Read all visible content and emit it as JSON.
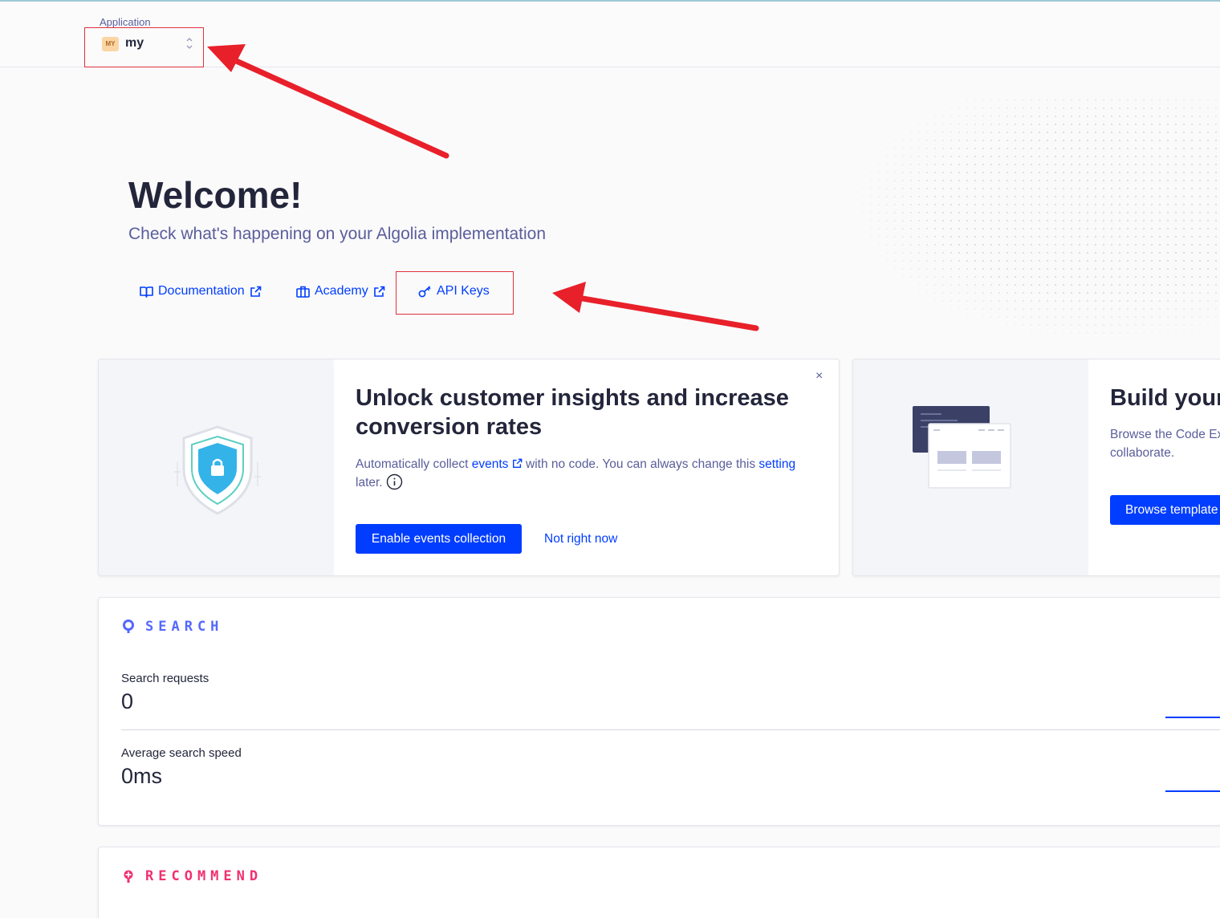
{
  "app_selector": {
    "label": "Application",
    "badge": "MY",
    "name": "my"
  },
  "welcome": {
    "title": "Welcome!",
    "subtitle": "Check what's happening on your Algolia implementation"
  },
  "links": {
    "documentation": "Documentation",
    "academy": "Academy",
    "api_keys": "API Keys"
  },
  "events_card": {
    "title_line1": "Unlock customer insights and increase",
    "title_line2": "conversion rates",
    "text_prefix": "Automatically collect ",
    "text_events": "events",
    "text_middle": " with no code. You can always change this ",
    "text_setting": "setting",
    "text_later": "later.",
    "enable_button": "Enable events collection",
    "dismiss_link": "Not right now",
    "close": "×"
  },
  "build_card": {
    "title": "Build your",
    "text_line1": "Browse the Code Ex",
    "text_line2": "collaborate.",
    "browse_button": "Browse template"
  },
  "search_section": {
    "label": "SEARCH",
    "color": "#5468ff",
    "metrics": [
      {
        "label": "Search requests",
        "value": "0"
      },
      {
        "label": "Average search speed",
        "value": "0ms"
      }
    ]
  },
  "recommend_section": {
    "label": "RECOMMEND",
    "color": "#f0306f"
  },
  "colors": {
    "accent": "#003dff",
    "annotation_red": "#e8202a"
  }
}
